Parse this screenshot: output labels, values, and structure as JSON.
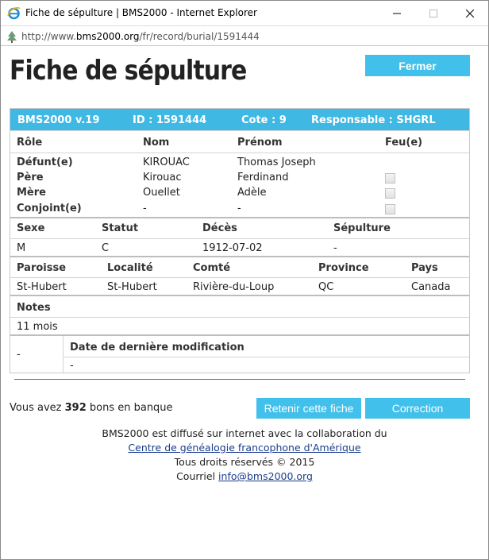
{
  "window": {
    "title": "Fiche de sépulture | BMS2000 - Internet Explorer",
    "url_prefix": "http://www.",
    "url_domain": "bms2000.org",
    "url_path": "/fr/record/burial/1591444"
  },
  "page": {
    "title": "Fiche de sépulture",
    "close_label": "Fermer"
  },
  "record": {
    "header": {
      "version": "BMS2000 v.19",
      "id": "ID : 1591444",
      "cote": "Cote : 9",
      "responsable": "Responsable : SHGRL"
    },
    "persons_headers": [
      "Rôle",
      "Nom",
      "Prénom",
      "Feu(e)"
    ],
    "persons": [
      {
        "role": "Défunt(e)",
        "nom": "KIROUAC",
        "prenom": "Thomas Joseph",
        "checkbox": false
      },
      {
        "role": "Père",
        "nom": "Kirouac",
        "prenom": "Ferdinand",
        "checkbox": true
      },
      {
        "role": "Mère",
        "nom": "Ouellet",
        "prenom": "Adèle",
        "checkbox": true
      },
      {
        "role": "Conjoint(e)",
        "nom": "-",
        "prenom": "-",
        "checkbox": true
      }
    ],
    "info_headers": [
      "Sexe",
      "Statut",
      "Décès",
      "Sépulture"
    ],
    "info_values": [
      "M",
      "C",
      "1912-07-02",
      "-"
    ],
    "place_headers": [
      "Paroisse",
      "Localité",
      "Comté",
      "Province",
      "Pays"
    ],
    "place_values": [
      "St-Hubert",
      "St-Hubert",
      "Rivière-du-Loup",
      "QC",
      "Canada"
    ],
    "notes_label": "Notes",
    "notes_value": "11 mois",
    "mod_left": "-",
    "mod_label": "Date de dernière modification",
    "mod_value": "-"
  },
  "bank": {
    "prefix": "Vous avez ",
    "count": "392",
    "suffix": " bons en banque"
  },
  "actions": {
    "retain_label": "Retenir cette fiche",
    "correction_label": "Correction"
  },
  "footer": {
    "line1": "BMS2000 est diffusé sur internet avec la collaboration du",
    "link1": "Centre de généalogie francophone d'Amérique",
    "line3": "Tous droits réservés © 2015",
    "line4_prefix": "Courriel ",
    "email": "info@bms2000.org"
  },
  "colors": {
    "accent": "#40c0ea",
    "header_bar": "#3fb8e4",
    "link": "#1a3d8f"
  }
}
